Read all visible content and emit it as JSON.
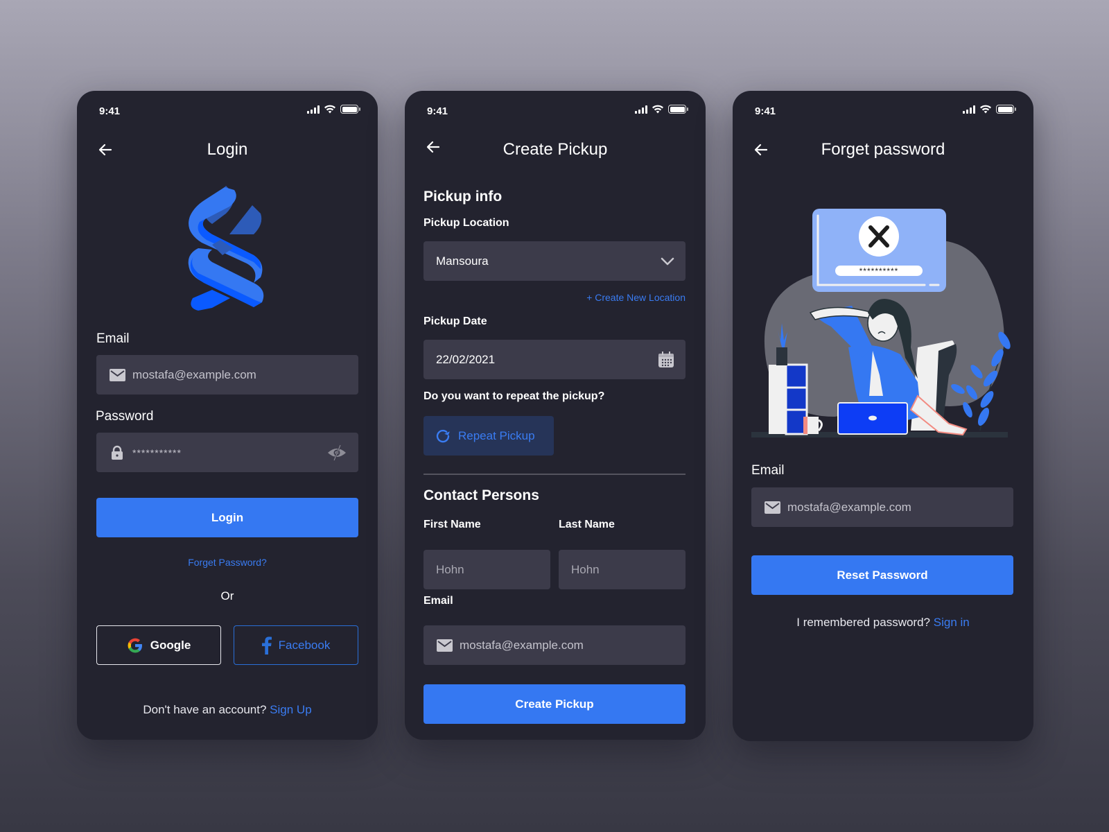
{
  "status_bar": {
    "time": "9:41"
  },
  "colors": {
    "accent": "#3578f2",
    "panel": "#23232f",
    "field": "#3c3b4a",
    "link": "#3a7cf2"
  },
  "login": {
    "title": "Login",
    "logo": "brand-ribbon-logo",
    "email_label": "Email",
    "email_value": "mostafa@example.com",
    "password_label": "Password",
    "password_value": "***********",
    "login_button": "Login",
    "forgot_link": "Forget Password?",
    "or_text": "Or",
    "google_button": "Google",
    "facebook_button": "Facebook",
    "signup_prompt": "Don't have an account?",
    "signup_link": "Sign Up"
  },
  "create_pickup": {
    "title": "Create Pickup",
    "section_pickup": "Pickup info",
    "location_label": "Pickup Location",
    "location_value": "Mansoura",
    "create_location_link": "+ Create New Location",
    "date_label": "Pickup Date",
    "date_value": "22/02/2021",
    "repeat_question": "Do you want to repeat the pickup?",
    "repeat_button": "Repeat Pickup",
    "section_contact": "Contact Persons",
    "first_name_label": "First Name",
    "first_name_placeholder": "Hohn",
    "last_name_label": "Last Name",
    "last_name_placeholder": "Hohn",
    "email_label": "Email",
    "email_value": "mostafa@example.com",
    "submit_button": "Create Pickup"
  },
  "forgot_password": {
    "title": "Forget password",
    "illustration_password": "**********",
    "email_label": "Email",
    "email_value": "mostafa@example.com",
    "reset_button": "Reset Password",
    "remember_prompt": "I remembered password?",
    "signin_link": "Sign in"
  }
}
